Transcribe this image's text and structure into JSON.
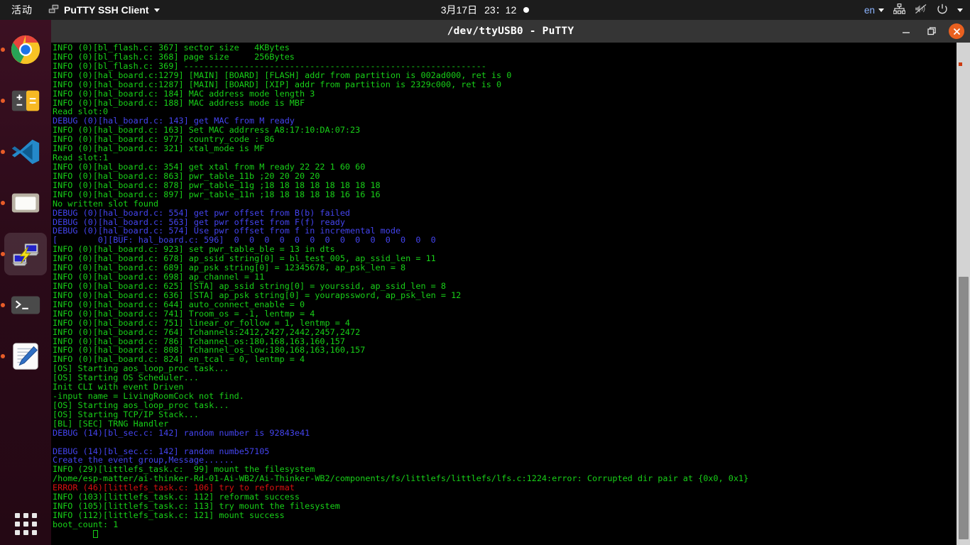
{
  "topbar": {
    "activities": "活动",
    "app_icon": "remote-desktop-icon",
    "app_name": "PuTTY SSH Client",
    "clock_date": "3月17日",
    "clock_time": "23：12",
    "notification_dot": "notification-dot",
    "language": "en",
    "icons": [
      "network-icon",
      "volume-muted-icon",
      "power-icon",
      "chevron-down-icon"
    ]
  },
  "dock": {
    "items": [
      {
        "name": "google-chrome",
        "running": true,
        "active": false
      },
      {
        "name": "calculator",
        "running": true,
        "active": false
      },
      {
        "name": "vscode",
        "running": true,
        "active": false
      },
      {
        "name": "files",
        "running": true,
        "active": false
      },
      {
        "name": "putty",
        "running": true,
        "active": true
      },
      {
        "name": "terminal",
        "running": true,
        "active": false
      },
      {
        "name": "text-editor",
        "running": true,
        "active": false
      }
    ],
    "app_grid": "show-applications"
  },
  "window": {
    "title": "/dev/ttyUSB0 - PuTTY",
    "minimize_label": "—",
    "maximize_label": "❐",
    "close_label": "✕",
    "close_color": "#e9601f"
  },
  "colors": {
    "green": "#18d018",
    "blue": "#4444ee",
    "red": "#d81010",
    "background": "#000000"
  },
  "terminal": {
    "lines": [
      {
        "t": "INFO (0)[bl_flash.c: 367] sector size   4KBytes",
        "c": "c-green"
      },
      {
        "t": "INFO (0)[bl_flash.c: 368] page size     256Bytes",
        "c": "c-green"
      },
      {
        "t": "INFO (0)[bl_flash.c: 369] ------------------------------------------------------------",
        "c": "c-green"
      },
      {
        "t": "INFO (0)[hal_board.c:1279] [MAIN] [BOARD] [FLASH] addr from partition is 002ad000, ret is 0",
        "c": "c-green"
      },
      {
        "t": "INFO (0)[hal_board.c:1287] [MAIN] [BOARD] [XIP] addr from partition is 2329c000, ret is 0",
        "c": "c-green"
      },
      {
        "t": "INFO (0)[hal_board.c: 184] MAC address mode length 3",
        "c": "c-green"
      },
      {
        "t": "INFO (0)[hal_board.c: 188] MAC address mode is MBF",
        "c": "c-green"
      },
      {
        "t": "Read slot:0",
        "c": "c-green"
      },
      {
        "t": "DEBUG (0)[hal_board.c: 143] get MAC from M ready",
        "c": "c-blue"
      },
      {
        "t": "INFO (0)[hal_board.c: 163] Set MAC addrress A8:17:10:DA:07:23",
        "c": "c-green"
      },
      {
        "t": "INFO (0)[hal_board.c: 977] country_code : 86",
        "c": "c-green"
      },
      {
        "t": "INFO (0)[hal_board.c: 321] xtal_mode is MF",
        "c": "c-green"
      },
      {
        "t": "Read slot:1",
        "c": "c-green"
      },
      {
        "t": "INFO (0)[hal_board.c: 354] get xtal from M ready 22 22 1 60 60",
        "c": "c-green"
      },
      {
        "t": "INFO (0)[hal_board.c: 863] pwr_table_11b ;20 20 20 20",
        "c": "c-green"
      },
      {
        "t": "INFO (0)[hal_board.c: 878] pwr_table_11g ;18 18 18 18 18 18 18 18",
        "c": "c-green"
      },
      {
        "t": "INFO (0)[hal_board.c: 897] pwr_table_11n ;18 18 18 18 18 16 16 16",
        "c": "c-green"
      },
      {
        "t": "No written slot found",
        "c": "c-green"
      },
      {
        "t": "DEBUG (0)[hal_board.c: 554] get pwr offset from B(b) failed",
        "c": "c-blue"
      },
      {
        "t": "DEBUG (0)[hal_board.c: 563] get pwr offset from F(f) ready",
        "c": "c-blue"
      },
      {
        "t": "DEBUG (0)[hal_board.c: 574] Use pwr offset from f in incremental mode",
        "c": "c-blue"
      },
      {
        "t": "[        0][BUF: hal_board.c: 596]  0  0  0  0  0  0  0  0  0  0  0  0  0  0",
        "c": "c-blue"
      },
      {
        "t": "INFO (0)[hal_board.c: 923] set pwr_table_ble = 13 in dts",
        "c": "c-green"
      },
      {
        "t": "INFO (0)[hal_board.c: 678] ap_ssid string[0] = bl_test_005, ap_ssid_len = 11",
        "c": "c-green"
      },
      {
        "t": "INFO (0)[hal_board.c: 689] ap_psk string[0] = 12345678, ap_psk_len = 8",
        "c": "c-green"
      },
      {
        "t": "INFO (0)[hal_board.c: 698] ap_channel = 11",
        "c": "c-green"
      },
      {
        "t": "INFO (0)[hal_board.c: 625] [STA] ap_ssid string[0] = yourssid, ap_ssid_len = 8",
        "c": "c-green"
      },
      {
        "t": "INFO (0)[hal_board.c: 636] [STA] ap_psk string[0] = yourapssword, ap_psk_len = 12",
        "c": "c-green"
      },
      {
        "t": "INFO (0)[hal_board.c: 644] auto_connect_enable = 0",
        "c": "c-green"
      },
      {
        "t": "INFO (0)[hal_board.c: 741] Troom_os = -1, lentmp = 4",
        "c": "c-green"
      },
      {
        "t": "INFO (0)[hal_board.c: 751] linear_or_follow = 1, lentmp = 4",
        "c": "c-green"
      },
      {
        "t": "INFO (0)[hal_board.c: 764] Tchannels:2412,2427,2442,2457,2472",
        "c": "c-green"
      },
      {
        "t": "INFO (0)[hal_board.c: 786] Tchannel_os:180,168,163,160,157",
        "c": "c-green"
      },
      {
        "t": "INFO (0)[hal_board.c: 808] Tchannel_os_low:180,168,163,160,157",
        "c": "c-green"
      },
      {
        "t": "INFO (0)[hal_board.c: 824] en_tcal = 0, lentmp = 4",
        "c": "c-green"
      },
      {
        "t": "[OS] Starting aos_loop_proc task...",
        "c": "c-green"
      },
      {
        "t": "[OS] Starting OS Scheduler...",
        "c": "c-green"
      },
      {
        "t": "Init CLI with event Driven",
        "c": "c-green"
      },
      {
        "t": "-input name = LivingRoomCock not find.",
        "c": "c-green"
      },
      {
        "t": "[OS] Starting aos_loop_proc task...",
        "c": "c-green"
      },
      {
        "t": "[OS] Starting TCP/IP Stack...",
        "c": "c-green"
      },
      {
        "t": "[BL] [SEC] TRNG Handler",
        "c": "c-green"
      },
      {
        "t": "DEBUG (14)[bl_sec.c: 142] random number is 92843e41",
        "c": "c-blue"
      },
      {
        "t": "",
        "c": "c-green"
      },
      {
        "t": "DEBUG (14)[bl_sec.c: 142] random numbe57105",
        "c": "c-blue"
      },
      {
        "t": "Create the event group,Message......",
        "c": "c-blue"
      },
      {
        "t": "INFO (29)[littlefs_task.c:  99] mount the filesystem",
        "c": "c-green"
      },
      {
        "t": "/home/esp-matter/ai-thinker-Rd-01-Ai-WB2/Ai-Thinker-WB2/components/fs/littlefs/littlefs/lfs.c:1224:error: Corrupted dir pair at {0x0, 0x1}",
        "c": "c-green"
      },
      {
        "t": "ERROR (46)[littlefs_task.c: 106] try to reformat",
        "c": "c-red"
      },
      {
        "t": "INFO (103)[littlefs_task.c: 112] reformat success",
        "c": "c-green"
      },
      {
        "t": "INFO (105)[littlefs_task.c: 113] try mount the filesystem",
        "c": "c-green"
      },
      {
        "t": "INFO (112)[littlefs_task.c: 121] mount success",
        "c": "c-green"
      },
      {
        "t": "boot_count: 1",
        "c": "c-green"
      }
    ],
    "cursor_row_indent": "        "
  },
  "scrollbar": {
    "orientation": "vertical",
    "thumb_position": "lower-half"
  }
}
